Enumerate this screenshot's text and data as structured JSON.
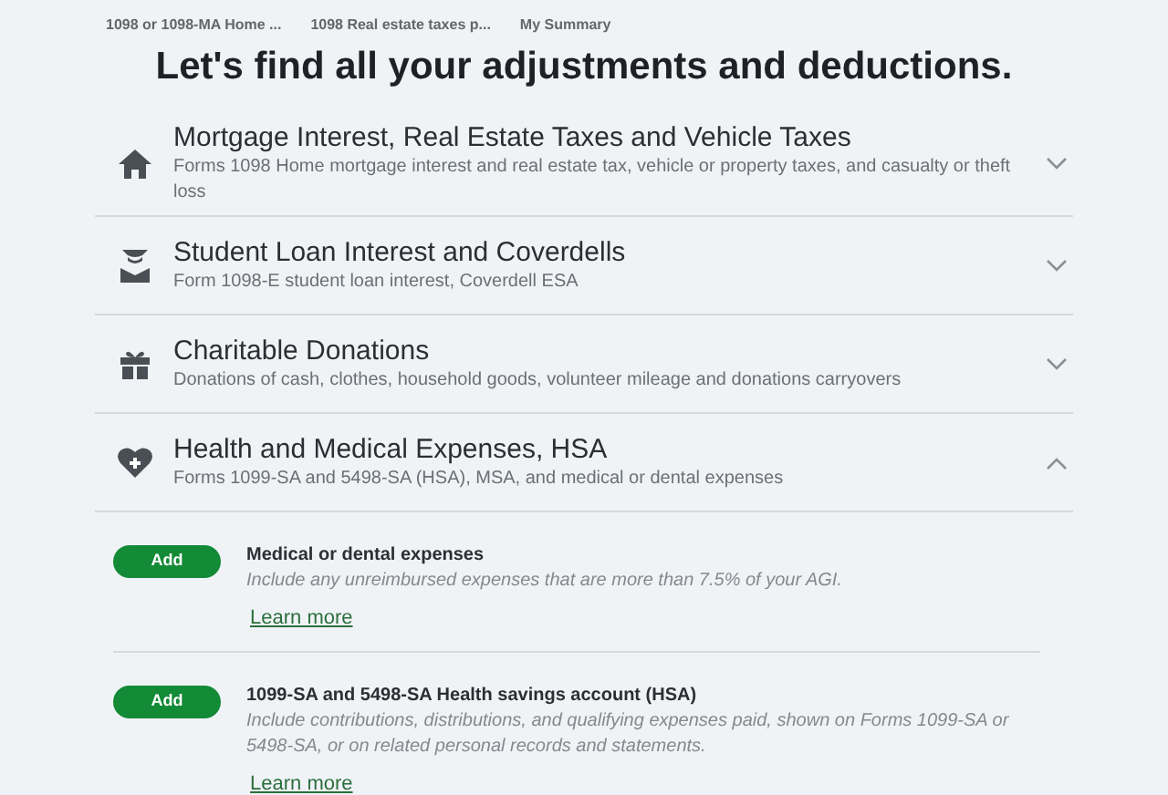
{
  "breadcrumbs": [
    "1098 or 1098-MA Home ...",
    "1098 Real estate taxes p...",
    "My Summary"
  ],
  "heading": "Let's find all your adjustments and deductions.",
  "categories": [
    {
      "kind": "house",
      "title": "Mortgage Interest, Real Estate Taxes and Vehicle Taxes",
      "description": "Forms 1098 Home mortgage interest and real estate tax, vehicle or property taxes, and casualty or theft loss",
      "expanded": false
    },
    {
      "kind": "graduate",
      "title": "Student Loan Interest and Coverdells",
      "description": "Form 1098-E student loan interest, Coverdell ESA",
      "expanded": false
    },
    {
      "kind": "gift",
      "title": "Charitable Donations",
      "description": "Donations of cash, clothes, household goods, volunteer mileage and donations carryovers",
      "expanded": false
    },
    {
      "kind": "heart",
      "title": "Health and Medical Expenses, HSA",
      "description": "Forms 1099-SA and 5498-SA (HSA), MSA, and medical or dental expenses",
      "expanded": true,
      "items": [
        {
          "button": "Add",
          "title": "Medical or dental expenses",
          "description": "Include any unreimbursed expenses that are more than 7.5% of your AGI.",
          "link": "Learn more"
        },
        {
          "button": "Add",
          "title": "1099-SA and 5498-SA Health savings account (HSA)",
          "description": "Include contributions, distributions, and qualifying expenses paid, shown on Forms 1099-SA or 5498-SA, or on related personal records and statements.",
          "link": "Learn more"
        }
      ]
    }
  ]
}
